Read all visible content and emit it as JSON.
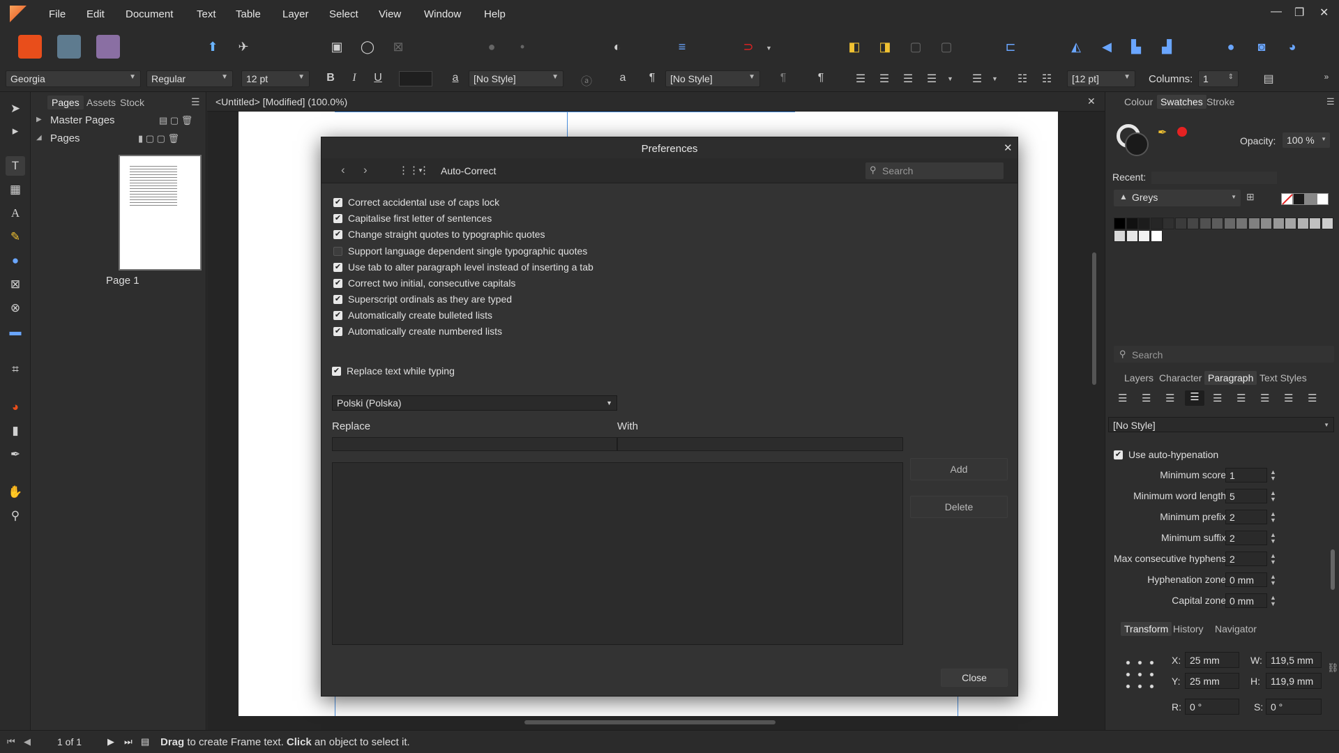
{
  "menu": {
    "items": [
      "File",
      "Edit",
      "Document",
      "Text",
      "Table",
      "Layer",
      "Select",
      "View",
      "Window",
      "Help"
    ]
  },
  "context_bar": {
    "font_family": "Georgia",
    "font_style": "Regular",
    "font_size": "12 pt",
    "char_style": "[No Style]",
    "para_style": "[No Style]",
    "leading": "[12 pt]",
    "columns_label": "Columns:",
    "columns_value": "1"
  },
  "pages_panel": {
    "tabs": [
      "Pages",
      "Assets",
      "Stock"
    ],
    "master_pages": "Master Pages",
    "pages": "Pages",
    "page_label": "Page 1"
  },
  "document": {
    "title": "<Untitled> [Modified] (100.0%)"
  },
  "dialog": {
    "title": "Preferences",
    "section": "Auto-Correct",
    "search_placeholder": "Search",
    "options": [
      {
        "label": "Correct accidental use of caps lock",
        "checked": true
      },
      {
        "label": "Capitalise first letter of sentences",
        "checked": true
      },
      {
        "label": "Change straight quotes to typographic quotes",
        "checked": true
      },
      {
        "label": "Support language dependent single typographic quotes",
        "checked": false
      },
      {
        "label": "Use tab to alter paragraph level instead of inserting a tab",
        "checked": true
      },
      {
        "label": "Correct two initial, consecutive capitals",
        "checked": true
      },
      {
        "label": "Superscript ordinals as they are typed",
        "checked": true
      },
      {
        "label": "Automatically create bulleted lists",
        "checked": true
      },
      {
        "label": "Automatically create numbered lists",
        "checked": true
      }
    ],
    "replace_while_typing": {
      "label": "Replace text while typing",
      "checked": true
    },
    "language": "Polski (Polska)",
    "replace_header": "Replace",
    "with_header": "With",
    "add_button": "Add",
    "delete_button": "Delete",
    "close_button": "Close"
  },
  "right_panel": {
    "top_tabs": [
      "Colour",
      "Swatches",
      "Stroke"
    ],
    "opacity_label": "Opacity:",
    "opacity_value": "100 %",
    "recent_label": "Recent:",
    "palette": "Greys",
    "grey_swatches": [
      "#000000",
      "#111111",
      "#1c1c1c",
      "#262626",
      "#303030",
      "#3b3b3b",
      "#464646",
      "#515151",
      "#5c5c5c",
      "#686868",
      "#747474",
      "#808080",
      "#8c8c8c",
      "#999999",
      "#a6a6a6",
      "#b3b3b3",
      "#c0c0c0",
      "#cdcdcd",
      "#d9d9d9",
      "#e6e6e6",
      "#f2f2f2",
      "#ffffff"
    ],
    "search_placeholder": "Search",
    "mid_tabs": [
      "Layers",
      "Character",
      "Paragraph",
      "Text Styles"
    ],
    "para_style": "[No Style]",
    "auto_hyphenation": {
      "label": "Use auto-hypenation",
      "checked": true
    },
    "hyphenation": [
      {
        "label": "Minimum score:",
        "value": "1"
      },
      {
        "label": "Minimum word length:",
        "value": "5"
      },
      {
        "label": "Minimum prefix:",
        "value": "2"
      },
      {
        "label": "Minimum suffix:",
        "value": "2"
      },
      {
        "label": "Max consecutive hyphens:",
        "value": "2"
      },
      {
        "label": "Hyphenation zone:",
        "value": "0 mm"
      },
      {
        "label": "Capital zone:",
        "value": "0 mm"
      }
    ],
    "bottom_tabs": [
      "Transform",
      "History",
      "Navigator"
    ],
    "transform": {
      "x_label": "X:",
      "x": "25 mm",
      "y_label": "Y:",
      "y": "25 mm",
      "w_label": "W:",
      "w": "119,5 mm",
      "h_label": "H:",
      "h": "119,9 mm",
      "r_label": "R:",
      "r": "0 °",
      "s_label": "S:",
      "s": "0 °"
    }
  },
  "status": {
    "page_count": "1 of 1",
    "hint_bold1": "Drag",
    "hint1": " to create Frame text. ",
    "hint_bold2": "Click",
    "hint2": " an object to select it."
  },
  "colors": {
    "accent": "#e94e1b",
    "record": "#e52222"
  }
}
